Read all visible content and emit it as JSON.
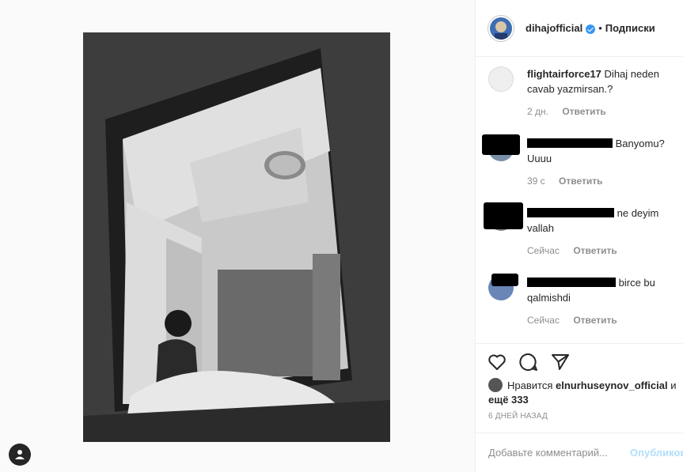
{
  "post": {
    "username": "dihajofficial",
    "separator": "•",
    "follow_label": "Подписки"
  },
  "comments": [
    {
      "username": "flightairforce17",
      "text": "Dihaj neden cavab yazmirsan.?",
      "time": "2 дн.",
      "reply": "Ответить",
      "redacted": false
    },
    {
      "username": "",
      "text": "Banyomu? Uuuu",
      "time": "39 с",
      "reply": "Ответить",
      "redacted": true
    },
    {
      "username": "",
      "text": "ne deyim vallah",
      "time": "Сейчас",
      "reply": "Ответить",
      "redacted": true
    },
    {
      "username": "",
      "text": "birce bu qalmishdi",
      "time": "Сейчас",
      "reply": "Ответить",
      "redacted": true
    }
  ],
  "likes": {
    "prefix": "Нравится",
    "user": "elnurhuseynov_official",
    "suffix": "и",
    "more": "ещё 333"
  },
  "date": "6 ДНЕЙ НАЗАД",
  "add_comment": {
    "placeholder": "Добавьте комментарий...",
    "post_label": "Опубликовать"
  },
  "icons": [
    "heart-icon",
    "comment-icon",
    "share-icon",
    "account-icon",
    "verified-icon"
  ]
}
